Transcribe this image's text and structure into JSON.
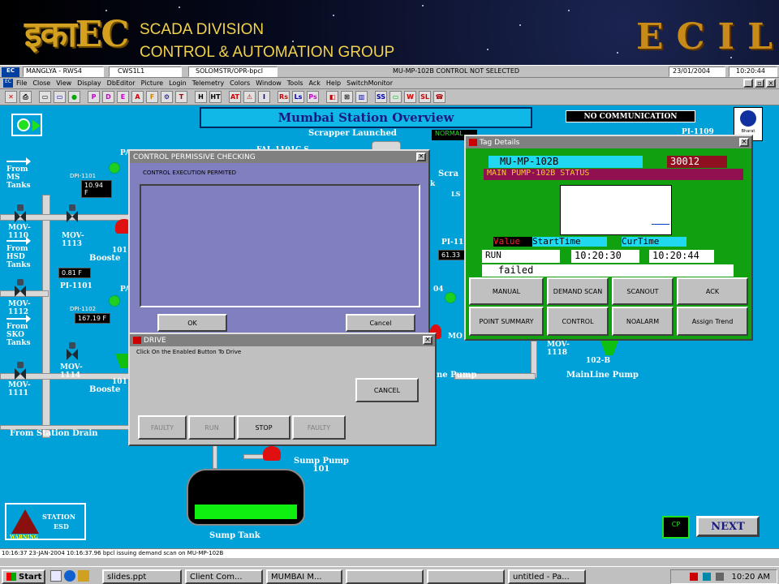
{
  "banner": {
    "logo_text": "इकाEC",
    "line1": "SCADA DIVISION",
    "line2": "CONTROL & AUTOMATION GROUP",
    "ecil": "ECIL"
  },
  "topinfo": {
    "station": "MANGLYA - RWS4",
    "node": "CWS1L1",
    "user": "SOLOMSTR/OPR-bpcl",
    "tag_status": "MU-MP-102B   CONTROL NOT SELECTED",
    "date": "23/01/2004",
    "time": "10:20:44"
  },
  "menu": [
    "File",
    "Close",
    "View",
    "Display",
    "DbEditor",
    "Picture",
    "Login",
    "Telemetry",
    "Colors",
    "Window",
    "Tools",
    "Ack",
    "Help",
    "SwitchMonitor"
  ],
  "toolbar": [
    "✕",
    "⎙",
    "▭",
    "▭",
    "●",
    "P",
    "D",
    "E",
    "A",
    "F",
    "⚙",
    "T",
    "H",
    "HT",
    "AT",
    "⚠",
    "I",
    "Rs",
    "Ls",
    "Ps",
    "◧",
    "⊞",
    "▥",
    "SS",
    "▭",
    "W",
    "SL",
    "☎"
  ],
  "process": {
    "title": "Mumbai Station Overview",
    "no_comm": "NO COMMUNICATION",
    "scrapper": "Scrapper Launched",
    "normal": "NORMAL",
    "pi1109": "PI-1109",
    "fal": "FAL-1101C S",
    "from_ms": "From\nMS\nTanks",
    "from_hsd": "From\nHSD\nTanks",
    "from_sko": "From\nSKO\nTanks",
    "mov1110": "MOV-\n1110",
    "mov1112": "MOV-\n1112",
    "mov1111": "MOV-\n1111",
    "mov1113": "MOV-\n1113",
    "mov1114": "MOV-\n1114",
    "mov1118": "MOV-\n1118",
    "dpi1101": "DPI-1101",
    "dpi1101_val": "10.94 F",
    "dpi1102": "DPI-1102",
    "dpi1102_val": "167.19 F",
    "pi1101": "PI-1101",
    "pi1101_val": "0.81 F",
    "pi11": "PI-11",
    "pi11_val": "61.33",
    "booster1": "Booste",
    "booster2": "Booste",
    "pa1": "PA",
    "pa2": "PA",
    "n101a": "101",
    "n101b": "101",
    "scra": "Scra",
    "k": "k",
    "ls": "LS",
    "n04": "04",
    "mo": "MO",
    "ne_pump": "ne Pump",
    "mainline_pump": "MainLine Pump",
    "n102b": "102-B",
    "from_drain": "From Station Drain",
    "sump_pump": "Sump Pump\n101",
    "sump_tank": "Sump Tank",
    "esd_station": "STATION",
    "esd_esd": "ESD",
    "warning": "WARNING",
    "next": "NEXT",
    "cp": "CP",
    "bharat": "Bharat",
    "um": "um"
  },
  "tag_details": {
    "title": "Tag Details",
    "tag": "MU-MP-102B",
    "id": "30012",
    "desc": "MAIN PUMP-102B STATUS",
    "col_value": "Value",
    "col_start": "StartTime",
    "col_cur": "CurTime",
    "value": "RUN",
    "start": "10:20:30",
    "cur": "10:20:44",
    "failed": "failed",
    "buttons": [
      "MANUAL",
      "DEMAND SCAN",
      "SCANOUT",
      "ACK",
      "POINT SUMMARY",
      "CONTROL",
      "NOALARM",
      "Assign Trend"
    ]
  },
  "control_permissive": {
    "title": "CONTROL PERMISSIVE CHECKING",
    "message": "CONTROL EXECUTION PERMITED",
    "ok": "OK",
    "cancel": "Cancel"
  },
  "drive": {
    "title": "DRIVE",
    "message": "Click On the Enabled Button To Drive",
    "cancel": "CANCEL",
    "faulty1": "FAULTY",
    "run": "RUN",
    "stop": "STOP",
    "faulty2": "FAULTY"
  },
  "statusline": "10:16:37 23-JAN-2004 10:16:37.96 bpcl issuing demand scan on MU-MP-102B",
  "taskbar": {
    "start": "Start",
    "items": [
      "slides.ppt",
      "Client Com...",
      "MUMBAI M...",
      "",
      "",
      "untitled - Pa..."
    ],
    "clock": "10:20 AM"
  }
}
